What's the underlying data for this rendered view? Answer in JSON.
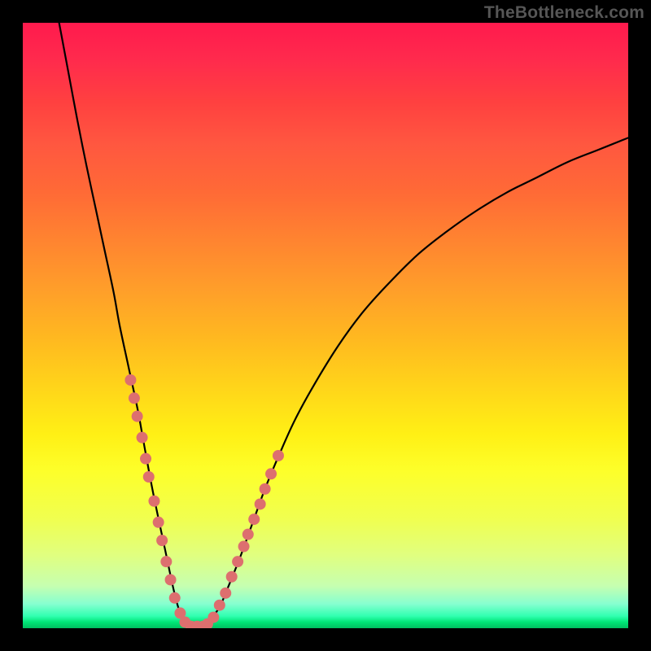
{
  "watermark": "TheBottleneck.com",
  "chart_data": {
    "type": "line",
    "title": "",
    "xlabel": "",
    "ylabel": "",
    "xlim": [
      0,
      100
    ],
    "ylim": [
      0,
      100
    ],
    "grid": false,
    "curve": [
      {
        "x": 6.0,
        "y": 100.0
      },
      {
        "x": 7.5,
        "y": 92.0
      },
      {
        "x": 9.0,
        "y": 84.0
      },
      {
        "x": 10.5,
        "y": 76.5
      },
      {
        "x": 12.0,
        "y": 69.5
      },
      {
        "x": 13.5,
        "y": 62.5
      },
      {
        "x": 15.0,
        "y": 55.5
      },
      {
        "x": 16.0,
        "y": 50.0
      },
      {
        "x": 17.5,
        "y": 43.0
      },
      {
        "x": 19.0,
        "y": 36.0
      },
      {
        "x": 20.0,
        "y": 30.5
      },
      {
        "x": 21.5,
        "y": 22.5
      },
      {
        "x": 23.5,
        "y": 13.0
      },
      {
        "x": 25.0,
        "y": 6.0
      },
      {
        "x": 26.0,
        "y": 2.5
      },
      {
        "x": 27.0,
        "y": 0.8
      },
      {
        "x": 28.0,
        "y": 0.3
      },
      {
        "x": 29.0,
        "y": 0.3
      },
      {
        "x": 30.0,
        "y": 0.5
      },
      {
        "x": 31.0,
        "y": 1.5
      },
      {
        "x": 32.5,
        "y": 3.5
      },
      {
        "x": 34.0,
        "y": 7.0
      },
      {
        "x": 36.0,
        "y": 12.0
      },
      {
        "x": 38.0,
        "y": 17.5
      },
      {
        "x": 40.0,
        "y": 23.0
      },
      {
        "x": 42.5,
        "y": 29.0
      },
      {
        "x": 45.0,
        "y": 34.5
      },
      {
        "x": 48.0,
        "y": 40.0
      },
      {
        "x": 52.0,
        "y": 46.5
      },
      {
        "x": 56.0,
        "y": 52.0
      },
      {
        "x": 60.0,
        "y": 56.5
      },
      {
        "x": 65.0,
        "y": 61.5
      },
      {
        "x": 70.0,
        "y": 65.5
      },
      {
        "x": 75.0,
        "y": 69.0
      },
      {
        "x": 80.0,
        "y": 72.0
      },
      {
        "x": 85.0,
        "y": 74.5
      },
      {
        "x": 90.0,
        "y": 77.0
      },
      {
        "x": 95.0,
        "y": 79.0
      },
      {
        "x": 100.0,
        "y": 81.0
      }
    ],
    "points": [
      {
        "x": 17.8,
        "y": 41.0
      },
      {
        "x": 18.4,
        "y": 38.0
      },
      {
        "x": 18.9,
        "y": 35.0
      },
      {
        "x": 19.7,
        "y": 31.5
      },
      {
        "x": 20.3,
        "y": 28.0
      },
      {
        "x": 20.8,
        "y": 25.0
      },
      {
        "x": 21.7,
        "y": 21.0
      },
      {
        "x": 22.4,
        "y": 17.5
      },
      {
        "x": 23.0,
        "y": 14.5
      },
      {
        "x": 23.7,
        "y": 11.0
      },
      {
        "x": 24.4,
        "y": 8.0
      },
      {
        "x": 25.1,
        "y": 5.0
      },
      {
        "x": 26.0,
        "y": 2.5
      },
      {
        "x": 26.8,
        "y": 1.0
      },
      {
        "x": 27.8,
        "y": 0.3
      },
      {
        "x": 28.8,
        "y": 0.3
      },
      {
        "x": 29.8,
        "y": 0.3
      },
      {
        "x": 30.5,
        "y": 0.7
      },
      {
        "x": 31.5,
        "y": 1.8
      },
      {
        "x": 32.5,
        "y": 3.8
      },
      {
        "x": 33.5,
        "y": 5.8
      },
      {
        "x": 34.5,
        "y": 8.5
      },
      {
        "x": 35.5,
        "y": 11.0
      },
      {
        "x": 36.5,
        "y": 13.5
      },
      {
        "x": 37.2,
        "y": 15.5
      },
      {
        "x": 38.2,
        "y": 18.0
      },
      {
        "x": 39.2,
        "y": 20.5
      },
      {
        "x": 40.0,
        "y": 23.0
      },
      {
        "x": 41.0,
        "y": 25.5
      },
      {
        "x": 42.2,
        "y": 28.5
      }
    ]
  }
}
